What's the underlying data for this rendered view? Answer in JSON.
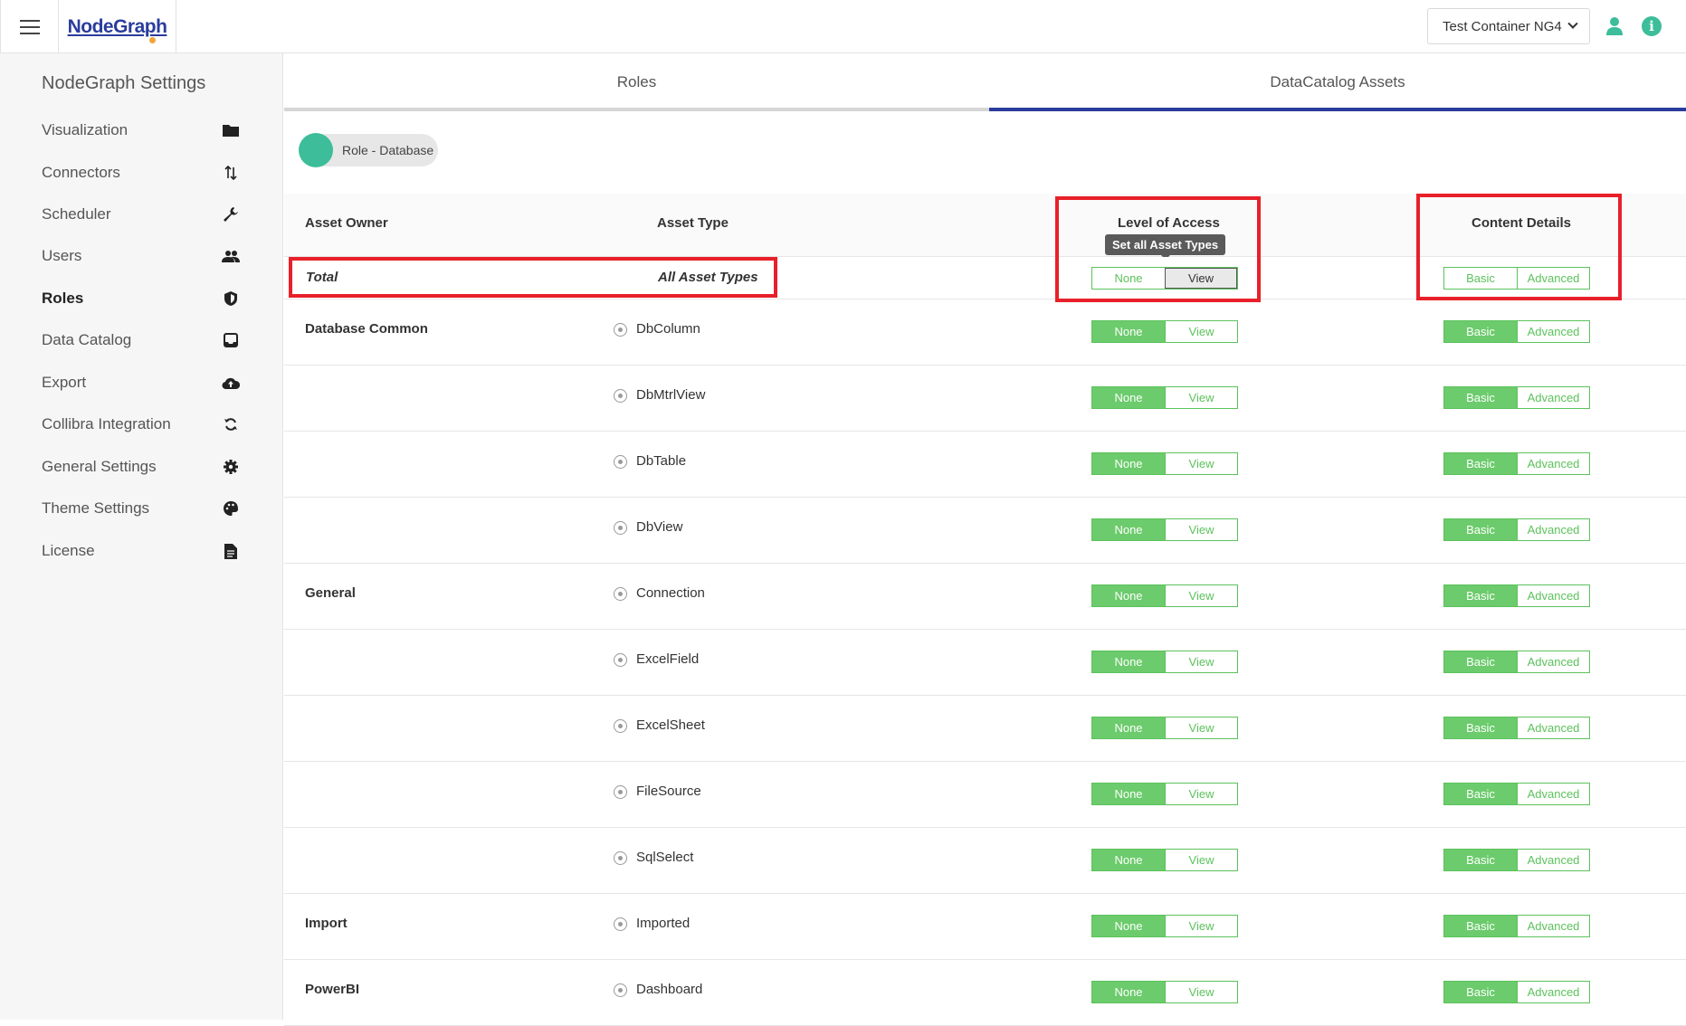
{
  "app": {
    "logo": "NodeGraph"
  },
  "header": {
    "container_select": "Test Container NG4"
  },
  "sidebar": {
    "title": "NodeGraph Settings",
    "items": [
      {
        "label": "Visualization",
        "icon": "folder-icon"
      },
      {
        "label": "Connectors",
        "icon": "arrows-up-down-icon"
      },
      {
        "label": "Scheduler",
        "icon": "wrench-icon"
      },
      {
        "label": "Users",
        "icon": "users-icon"
      },
      {
        "label": "Roles",
        "icon": "shield-icon",
        "active": true
      },
      {
        "label": "Data Catalog",
        "icon": "inbox-icon"
      },
      {
        "label": "Export",
        "icon": "cloud-upload-icon"
      },
      {
        "label": "Collibra Integration",
        "icon": "sync-icon"
      },
      {
        "label": "General Settings",
        "icon": "gear-icon"
      },
      {
        "label": "Theme Settings",
        "icon": "palette-icon"
      },
      {
        "label": "License",
        "icon": "document-icon"
      }
    ]
  },
  "tabs": [
    {
      "label": "Roles"
    },
    {
      "label": "DataCatalog Assets",
      "active": true
    }
  ],
  "role_chip": {
    "label": "Role - Database"
  },
  "table": {
    "headers": {
      "asset_owner": "Asset Owner",
      "asset_type": "Asset Type",
      "level_of_access": "Level of Access",
      "content_details": "Content Details"
    },
    "tooltip": "Set all Asset Types",
    "total": {
      "owner": "Total",
      "type": "All Asset Types",
      "access_options": [
        "None",
        "View"
      ],
      "access_selected": "View",
      "detail_options": [
        "Basic",
        "Advanced"
      ]
    },
    "rows": [
      {
        "owner": "Database Common",
        "type": "DbColumn",
        "access": [
          "None",
          "View"
        ],
        "details": [
          "Basic",
          "Advanced"
        ]
      },
      {
        "owner": "",
        "type": "DbMtrlView",
        "access": [
          "None",
          "View"
        ],
        "details": [
          "Basic",
          "Advanced"
        ]
      },
      {
        "owner": "",
        "type": "DbTable",
        "access": [
          "None",
          "View"
        ],
        "details": [
          "Basic",
          "Advanced"
        ]
      },
      {
        "owner": "",
        "type": "DbView",
        "access": [
          "None",
          "View"
        ],
        "details": [
          "Basic",
          "Advanced"
        ]
      },
      {
        "owner": "General",
        "type": "Connection",
        "access": [
          "None",
          "View"
        ],
        "details": [
          "Basic",
          "Advanced"
        ]
      },
      {
        "owner": "",
        "type": "ExcelField",
        "access": [
          "None",
          "View"
        ],
        "details": [
          "Basic",
          "Advanced"
        ]
      },
      {
        "owner": "",
        "type": "ExcelSheet",
        "access": [
          "None",
          "View"
        ],
        "details": [
          "Basic",
          "Advanced"
        ]
      },
      {
        "owner": "",
        "type": "FileSource",
        "access": [
          "None",
          "View"
        ],
        "details": [
          "Basic",
          "Advanced"
        ]
      },
      {
        "owner": "",
        "type": "SqlSelect",
        "access": [
          "None",
          "View"
        ],
        "details": [
          "Basic",
          "Advanced"
        ]
      },
      {
        "owner": "Import",
        "type": "Imported",
        "access": [
          "None",
          "View"
        ],
        "details": [
          "Basic",
          "Advanced"
        ]
      },
      {
        "owner": "PowerBI",
        "type": "Dashboard",
        "access": [
          "None",
          "View"
        ],
        "details": [
          "Basic",
          "Advanced"
        ]
      }
    ]
  },
  "colors": {
    "accent": "#3dbd9a",
    "brand": "#2a3c9c",
    "toggle_green": "#6ccb6c",
    "highlight_red": "#e8202a"
  }
}
